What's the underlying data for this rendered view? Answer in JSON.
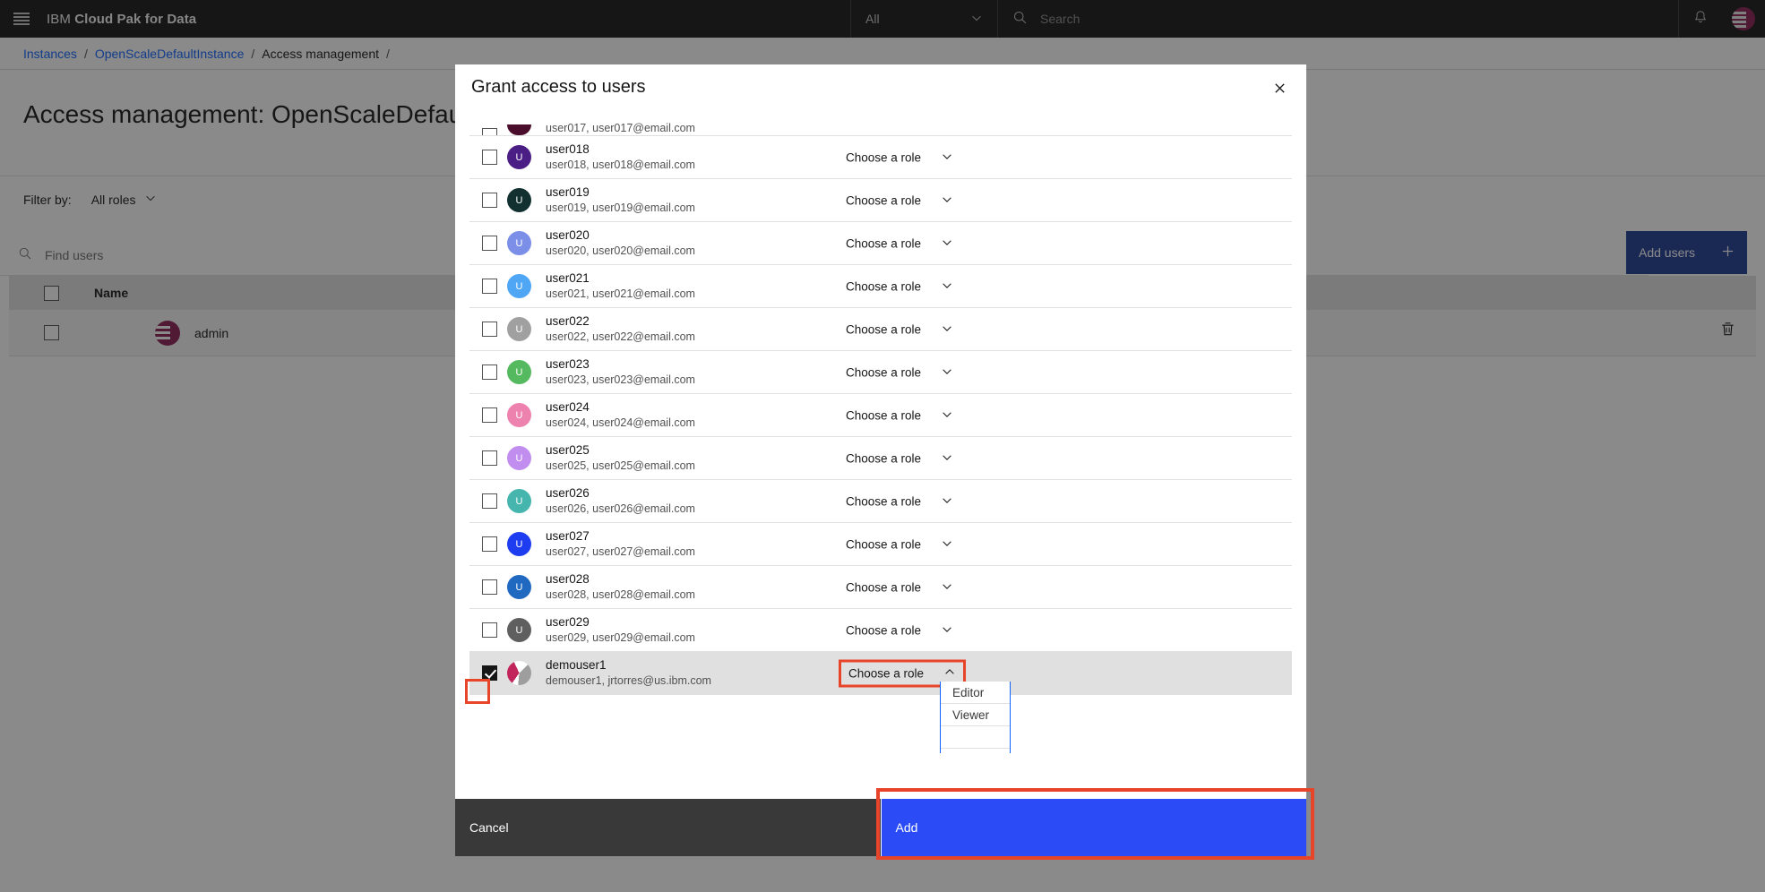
{
  "topbar": {
    "menu_icon": "hamburger-icon",
    "brand_ibm": "IBM",
    "brand_rest": "Cloud Pak for Data",
    "scope_label": "All",
    "search_placeholder": "Search",
    "notification_icon": "bell-icon",
    "avatar_icon": "user-avatar-icon"
  },
  "breadcrumb": {
    "items": [
      "Instances",
      "OpenScaleDefaultInstance",
      "Access management"
    ],
    "separator": "/"
  },
  "page": {
    "title": "Access management: OpenScaleDefau",
    "filter_label": "Filter by:",
    "filter_value": "All roles",
    "find_users_placeholder": "Find users",
    "add_users_label": "Add users",
    "add_users_icon": "plus-icon",
    "table_header_name": "Name",
    "rows": [
      {
        "name": "admin",
        "avatar": "ibm-logo-avatar",
        "delete_icon": "trash-icon"
      }
    ]
  },
  "modal": {
    "title": "Grant access to users",
    "close_icon": "close-icon",
    "role_placeholder": "Choose a role",
    "chevron_down_icon": "chevron-down-icon",
    "chevron_up_icon": "chevron-up-icon",
    "partial_top_row": {
      "email": "user017, user017@email.com",
      "avatar_color": "#4a0d2b"
    },
    "users": [
      {
        "name": "user018",
        "email": "user018, user018@email.com",
        "initial": "U",
        "color": "#4b1e86",
        "checked": false,
        "role": "Choose a role"
      },
      {
        "name": "user019",
        "email": "user019, user019@email.com",
        "initial": "U",
        "color": "#123030",
        "checked": false,
        "role": "Choose a role"
      },
      {
        "name": "user020",
        "email": "user020, user020@email.com",
        "initial": "U",
        "color": "#7b8ee8",
        "checked": false,
        "role": "Choose a role"
      },
      {
        "name": "user021",
        "email": "user021, user021@email.com",
        "initial": "U",
        "color": "#4ea6f5",
        "checked": false,
        "role": "Choose a role"
      },
      {
        "name": "user022",
        "email": "user022, user022@email.com",
        "initial": "U",
        "color": "#a0a0a0",
        "checked": false,
        "role": "Choose a role"
      },
      {
        "name": "user023",
        "email": "user023, user023@email.com",
        "initial": "U",
        "color": "#55ba5f",
        "checked": false,
        "role": "Choose a role"
      },
      {
        "name": "user024",
        "email": "user024, user024@email.com",
        "initial": "U",
        "color": "#ee82ae",
        "checked": false,
        "role": "Choose a role"
      },
      {
        "name": "user025",
        "email": "user025, user025@email.com",
        "initial": "U",
        "color": "#c18ef0",
        "checked": false,
        "role": "Choose a role"
      },
      {
        "name": "user026",
        "email": "user026, user026@email.com",
        "initial": "U",
        "color": "#45b5ad",
        "checked": false,
        "role": "Choose a role"
      },
      {
        "name": "user027",
        "email": "user027, user027@email.com",
        "initial": "U",
        "color": "#1f3df0",
        "checked": false,
        "role": "Choose a role"
      },
      {
        "name": "user028",
        "email": "user028, user028@email.com",
        "initial": "U",
        "color": "#1f69c0",
        "checked": false,
        "role": "Choose a role"
      },
      {
        "name": "user029",
        "email": "user029, user029@email.com",
        "initial": "U",
        "color": "#5f5f5f",
        "checked": false,
        "role": "Choose a role"
      },
      {
        "name": "demouser1",
        "email": "demouser1, jrtorres@us.ibm.com",
        "initial": "",
        "color": "",
        "checked": true,
        "role": "Choose a role"
      }
    ],
    "role_options": [
      "Editor",
      "Viewer"
    ],
    "footer": {
      "cancel_label": "Cancel",
      "add_label": "Add"
    }
  },
  "colors": {
    "accent_blue": "#0f62fe",
    "add_button_blue": "#2a4bf5",
    "add_users_blue": "#1f3a93",
    "annotation_red": "#e8442a",
    "header_dark": "#161616"
  }
}
